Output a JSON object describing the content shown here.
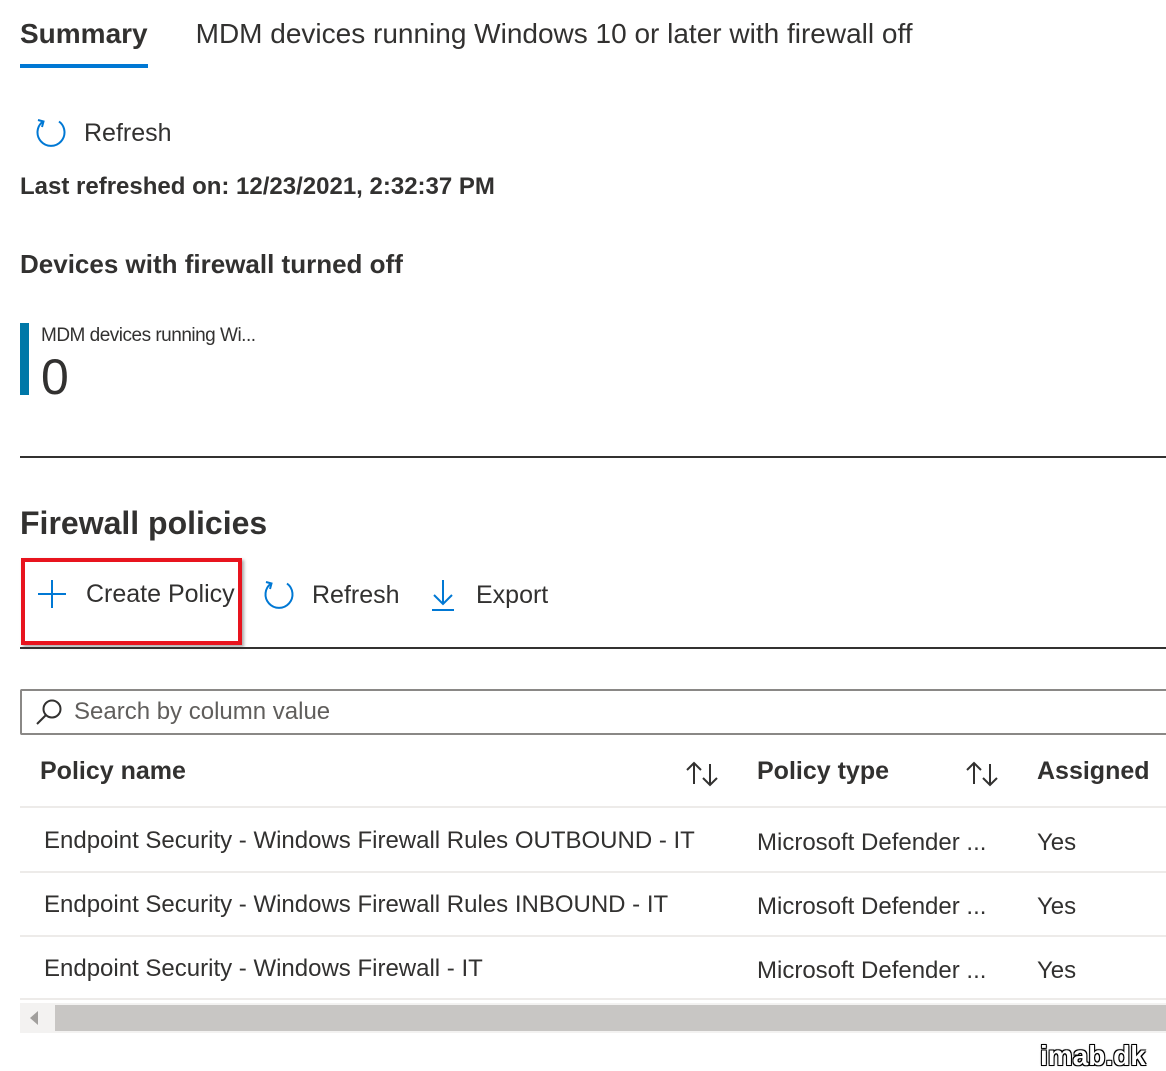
{
  "tabs": [
    {
      "label": "Summary",
      "active": true
    },
    {
      "label": "MDM devices running Windows 10 or later with firewall off",
      "active": false
    }
  ],
  "top_toolbar": {
    "refresh_label": "Refresh",
    "refresh_icon": "refresh-icon"
  },
  "last_refreshed": "Last refreshed on: 12/23/2021, 2:32:37 PM",
  "devices_section": {
    "title": "Devices with firewall turned off",
    "tile": {
      "label": "MDM devices running Wi...",
      "value": "0",
      "accent_color": "#0078a8"
    }
  },
  "firewall_policies": {
    "title": "Firewall policies",
    "commands": {
      "create_label": "Create Policy",
      "create_icon": "plus-icon",
      "refresh_label": "Refresh",
      "refresh_icon": "refresh-icon",
      "export_label": "Export",
      "export_icon": "download-icon"
    },
    "highlight_color": "#e8141e",
    "search": {
      "placeholder": "Search by column value",
      "value": "",
      "icon": "search-icon"
    },
    "columns": {
      "policy_name": "Policy name",
      "policy_type": "Policy type",
      "assigned": "Assigned"
    },
    "rows": [
      {
        "name": "Endpoint Security - Windows Firewall Rules OUTBOUND - IT",
        "type": "Microsoft Defender ...",
        "assigned": "Yes"
      },
      {
        "name": "Endpoint Security - Windows Firewall Rules INBOUND - IT",
        "type": "Microsoft Defender ...",
        "assigned": "Yes"
      },
      {
        "name": "Endpoint Security - Windows Firewall - IT",
        "type": "Microsoft Defender ...",
        "assigned": "Yes"
      }
    ]
  },
  "watermark": "imab.dk",
  "colors": {
    "accent": "#0078d4",
    "text": "#323130"
  }
}
